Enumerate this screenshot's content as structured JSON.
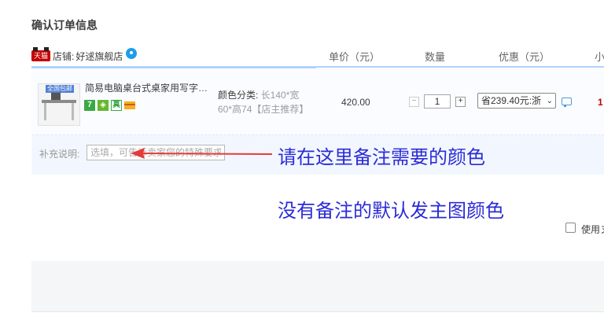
{
  "page": {
    "title": "确认订单信息"
  },
  "store": {
    "label": "店铺:",
    "name": "好逑旗舰店",
    "tmall_badge": "天猫"
  },
  "columns": {
    "price": "单价（元）",
    "quantity": "数量",
    "discount": "优惠（元）",
    "subtotal": "小"
  },
  "item": {
    "thumb_badge": "全国包邮",
    "title": "简易电脑桌台式桌家用写字…",
    "sku_label": "颜色分类:",
    "sku_value": " 长140*宽60*高74【店主推荐】",
    "price": "420.00",
    "quantity": "1",
    "qty_minus": "−",
    "qty_plus": "+",
    "discount_text": "省239.40元:浙",
    "subtotal": "1",
    "service_icons": [
      "seven-day-return-icon",
      "guarantee-shield-icon",
      "authentic-zhen-icon",
      "credit-card-icon"
    ],
    "service_glyphs": {
      "seven": "7",
      "zhen": "真"
    }
  },
  "note": {
    "label": "补充说明:",
    "placeholder": "选填，可告诉卖家您的特殊要求"
  },
  "annotations": {
    "line1": "请在这里备注需要的颜色",
    "line2": "没有备注的默认发主图颜色",
    "arrow_color": "#e53b3b",
    "text_color": "#2b2bd6"
  },
  "anonymous": {
    "label": "使用ヌ"
  }
}
